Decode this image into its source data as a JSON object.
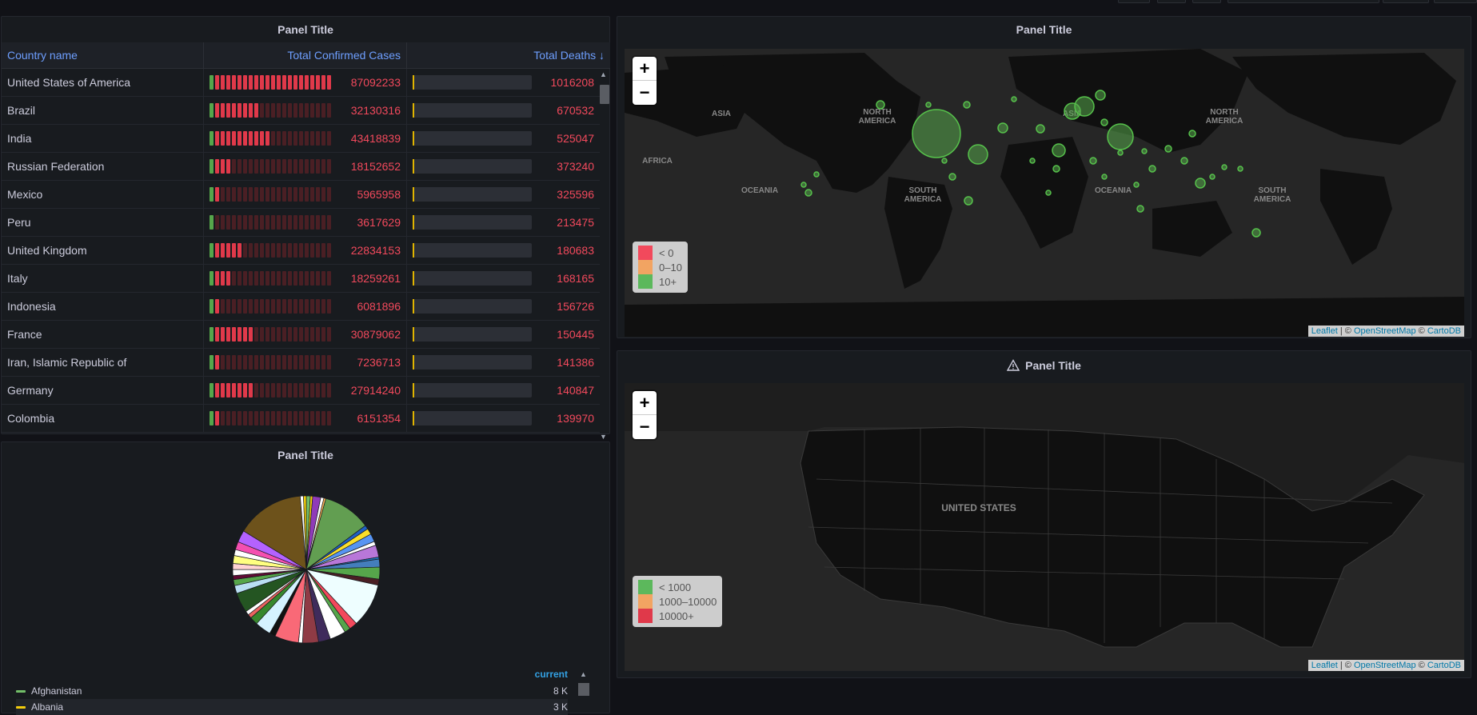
{
  "table_panel": {
    "title": "Panel Title",
    "columns": [
      "Country name",
      "Total Confirmed Cases",
      "Total Deaths ↓"
    ],
    "rows": [
      {
        "country": "United States of America",
        "cases": "87092233",
        "deaths": "1016208",
        "cases_lit": 22
      },
      {
        "country": "Brazil",
        "cases": "32130316",
        "deaths": "670532",
        "cases_lit": 9
      },
      {
        "country": "India",
        "cases": "43418839",
        "deaths": "525047",
        "cases_lit": 11
      },
      {
        "country": "Russian Federation",
        "cases": "18152652",
        "deaths": "373240",
        "cases_lit": 4
      },
      {
        "country": "Mexico",
        "cases": "5965958",
        "deaths": "325596",
        "cases_lit": 2
      },
      {
        "country": "Peru",
        "cases": "3617629",
        "deaths": "213475",
        "cases_lit": 1
      },
      {
        "country": "United Kingdom",
        "cases": "22834153",
        "deaths": "180683",
        "cases_lit": 6
      },
      {
        "country": "Italy",
        "cases": "18259261",
        "deaths": "168165",
        "cases_lit": 4
      },
      {
        "country": "Indonesia",
        "cases": "6081896",
        "deaths": "156726",
        "cases_lit": 2
      },
      {
        "country": "France",
        "cases": "30879062",
        "deaths": "150445",
        "cases_lit": 8
      },
      {
        "country": "Iran, Islamic Republic of",
        "cases": "7236713",
        "deaths": "141386",
        "cases_lit": 2
      },
      {
        "country": "Germany",
        "cases": "27914240",
        "deaths": "140847",
        "cases_lit": 8
      },
      {
        "country": "Colombia",
        "cases": "6151354",
        "deaths": "139970",
        "cases_lit": 2
      }
    ]
  },
  "world_map_panel": {
    "title": "Panel Title",
    "zoom_in": "+",
    "zoom_out": "−",
    "labels": [
      "ASIA",
      "NORTH AMERICA",
      "AFRICA",
      "OCEANIA",
      "SOUTH AMERICA",
      "ASIA",
      "NORTH AMERICA",
      "OCEANIA",
      "SOUTH AMERICA"
    ],
    "legend": [
      {
        "label": "< 0",
        "color": "#f2495c"
      },
      {
        "label": "0–10",
        "color": "#ff9830"
      },
      {
        "label": "10+",
        "color": "#56a64b"
      }
    ],
    "attribution": {
      "leaflet": "Leaflet",
      "sep": " | © ",
      "osm": "OpenStreetMap",
      "sep2": " © ",
      "carto": "CartoDB"
    }
  },
  "us_map_panel": {
    "title": "Panel Title",
    "zoom_in": "+",
    "zoom_out": "−",
    "country_label": "UNITED STATES",
    "legend": [
      {
        "label": "< 1000",
        "color": "#56a64b"
      },
      {
        "label": "1000–10000",
        "color": "#ff9830"
      },
      {
        "label": "10000+",
        "color": "#f2495c"
      }
    ],
    "attribution": {
      "leaflet": "Leaflet",
      "sep": " | © ",
      "osm": "OpenStreetMap",
      "sep2": " © ",
      "carto": "CartoDB"
    }
  },
  "pie_panel": {
    "title": "Panel Title",
    "legend_header": "current",
    "legend_items": [
      {
        "name": "Afghanistan",
        "value": "8 K",
        "color": "#73bf69"
      },
      {
        "name": "Albania",
        "value": "3 K",
        "color": "#f2cc0c"
      }
    ]
  },
  "colors": {
    "background": "#111217",
    "panel": "#181b1f",
    "accent_blue": "#6e9fff",
    "red": "#f2495c",
    "green": "#56a64b"
  }
}
